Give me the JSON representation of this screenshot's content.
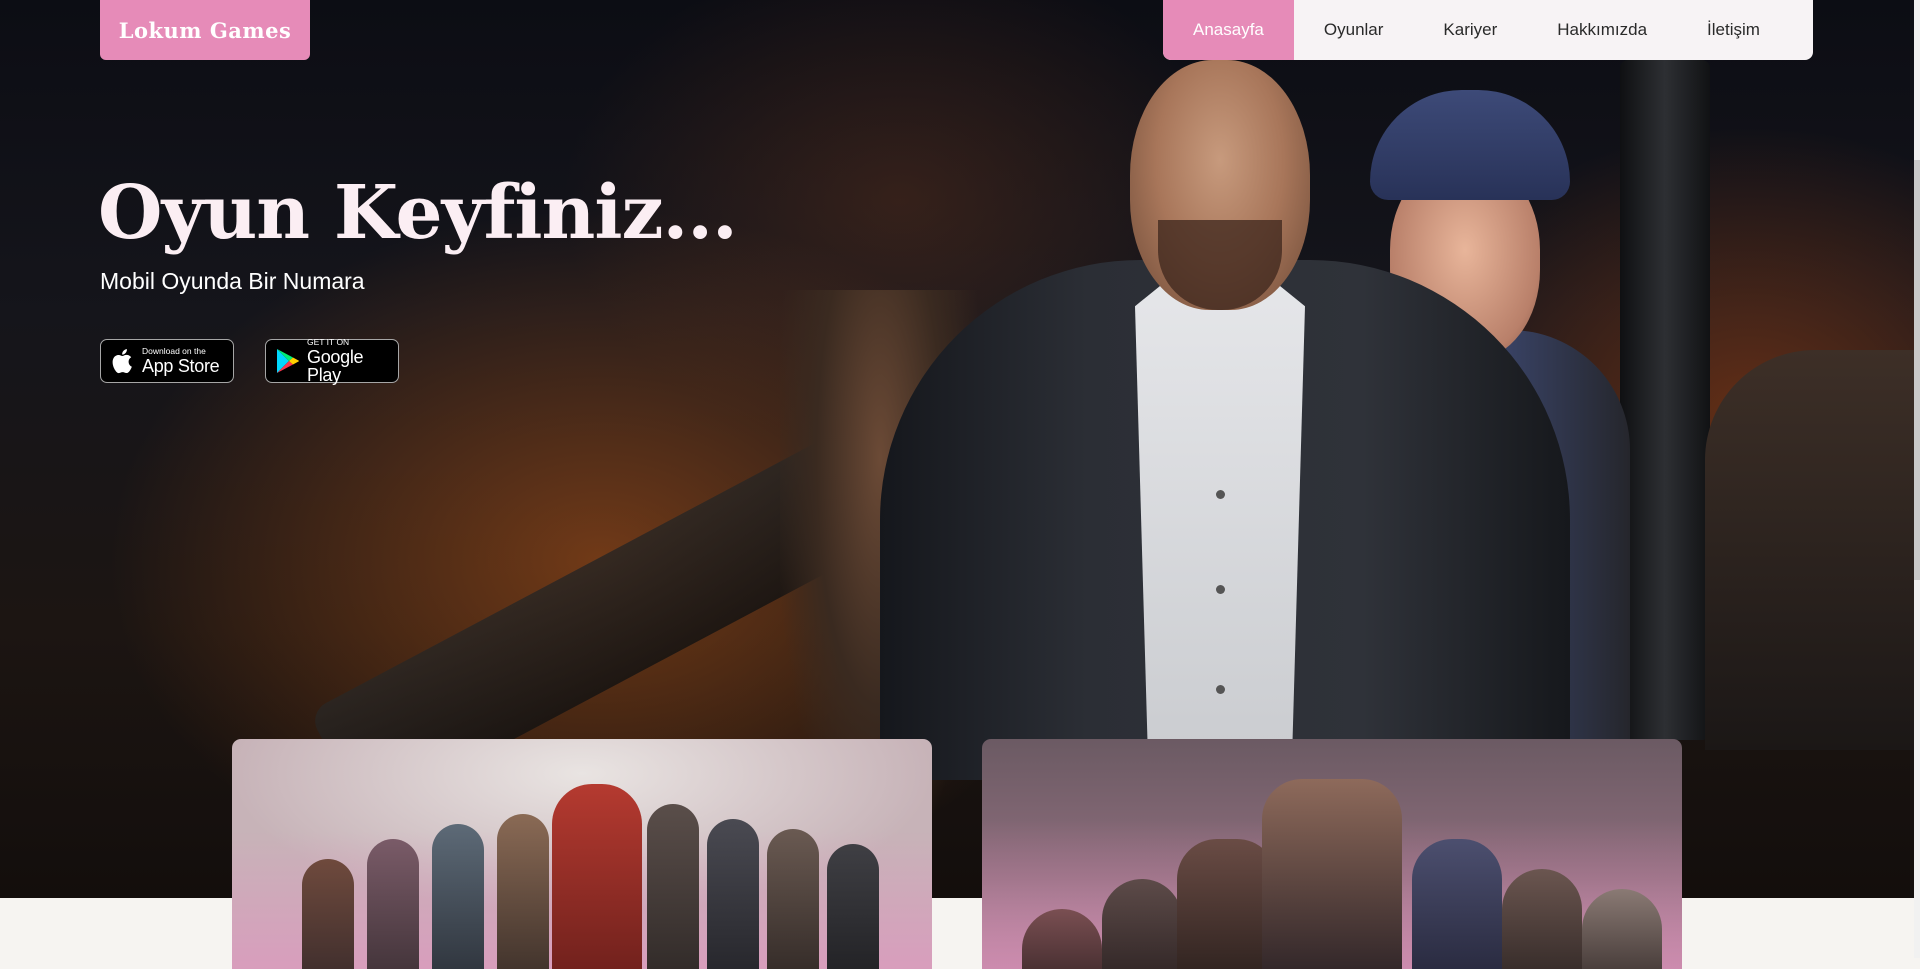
{
  "brand": {
    "logo_text": "Lokum Games"
  },
  "nav": {
    "items": [
      {
        "label": "Anasayfa",
        "active": true
      },
      {
        "label": "Oyunlar",
        "active": false
      },
      {
        "label": "Kariyer",
        "active": false
      },
      {
        "label": "Hakkımızda",
        "active": false
      },
      {
        "label": "İletişim",
        "active": false
      }
    ]
  },
  "hero": {
    "title": "Oyun Keyfiniz...",
    "subtitle": "Mobil Oyunda Bir Numara"
  },
  "store_badges": {
    "app_store": {
      "small": "Download on the",
      "big": "App Store",
      "icon": "apple-icon"
    },
    "google_play": {
      "small": "GET IT ON",
      "big": "Google Play",
      "icon": "google-play-icon"
    }
  },
  "colors": {
    "accent": "#e68bb8",
    "nav_background": "#f7f3f5",
    "page_background": "#f6f4f1"
  }
}
